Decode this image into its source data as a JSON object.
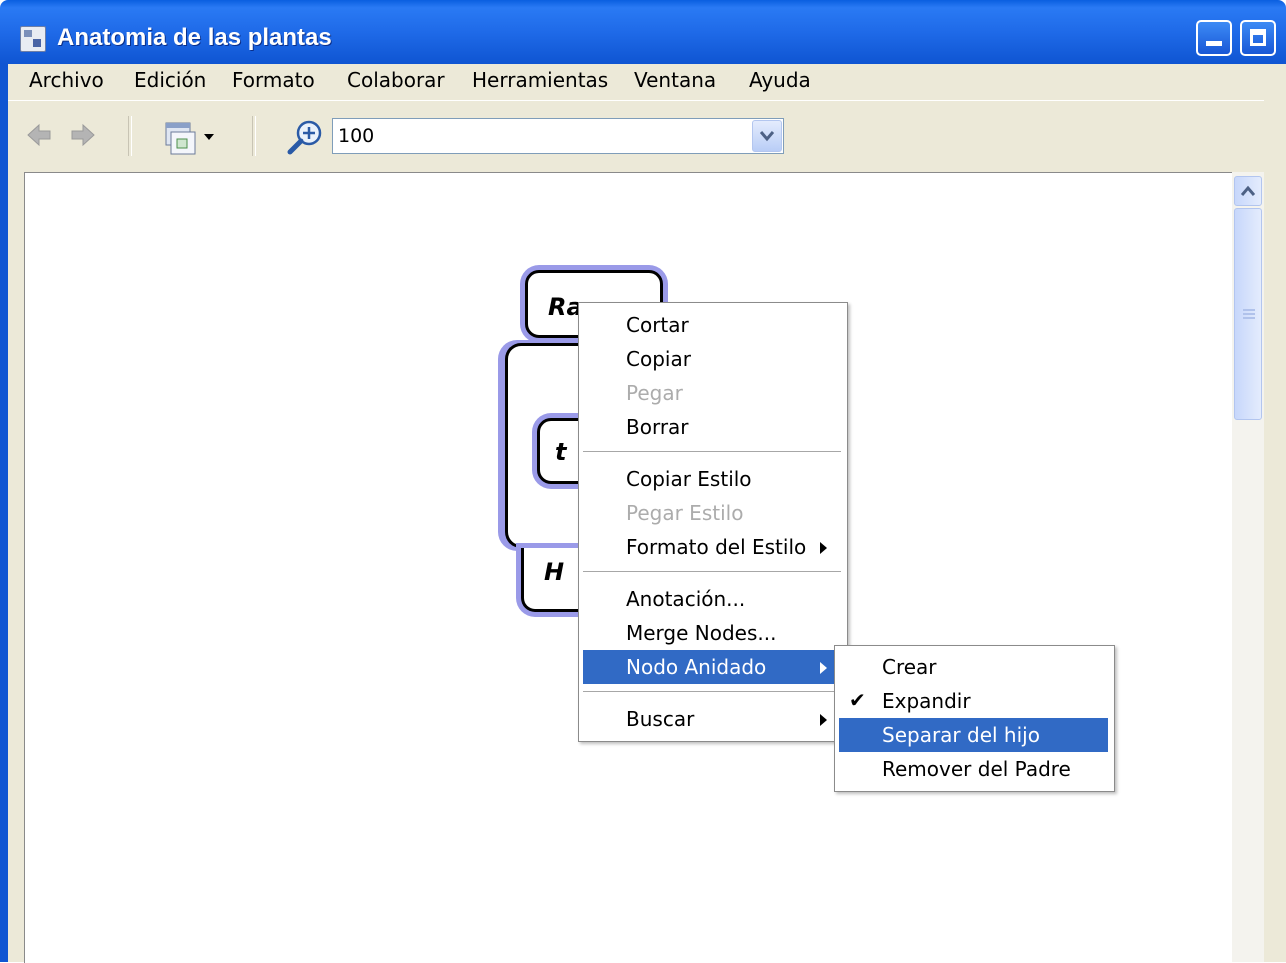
{
  "window": {
    "title": "Anatomia de las plantas"
  },
  "menubar": [
    "Archivo",
    "Edición",
    "Formato",
    "Colaborar",
    "Herramientas",
    "Ventana",
    "Ayuda"
  ],
  "toolbar": {
    "zoom_value": "100"
  },
  "nodes": {
    "top": "Ra",
    "inner": "t",
    "bottom": "H"
  },
  "context_menu": {
    "items": [
      "Cortar",
      "Copiar",
      "Pegar",
      "Borrar",
      "Copiar Estilo",
      "Pegar Estilo",
      "Formato del Estilo",
      "Anotación...",
      "Merge Nodes...",
      "Nodo Anidado",
      "Buscar"
    ],
    "disabled": [
      "Pegar",
      "Pegar Estilo"
    ],
    "highlighted": "Nodo Anidado"
  },
  "submenu": {
    "items": [
      "Crear",
      "Expandir",
      "Separar del hijo",
      "Remover del Padre"
    ],
    "checked": "Expandir",
    "highlighted": "Separar del hijo"
  },
  "colors": {
    "title_bar": "#1f6ae8",
    "menu_highlight": "#316ac5",
    "node_halo": "#9a9ae8"
  }
}
